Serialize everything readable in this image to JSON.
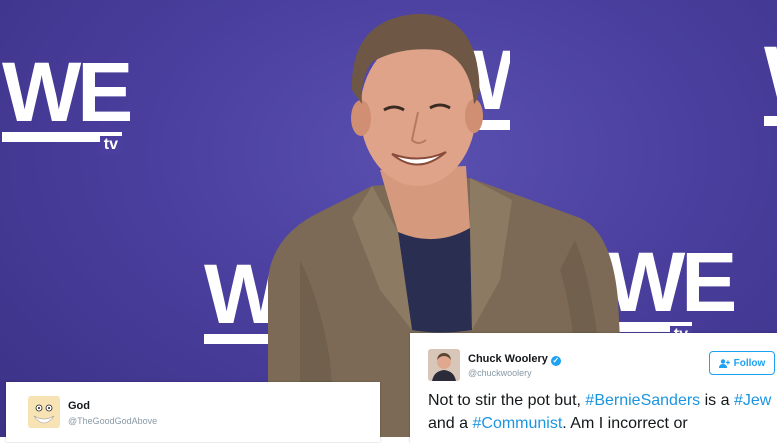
{
  "photo": {
    "backdrop_color": "#4a3f9e",
    "logo_text": "WE",
    "logo_sub": "tv"
  },
  "tweet_god": {
    "name": "God",
    "handle": "@TheGoodGodAbove"
  },
  "tweet_chuck": {
    "name": "Chuck Woolery",
    "verified": "✓",
    "handle": "@chuckwoolery",
    "follow_label": "Follow",
    "text_1": "Not to stir the pot but, ",
    "tag_bernie": "#BernieSanders",
    "text_2": " is a ",
    "tag_jew": "#Jew",
    "text_3": " and a ",
    "tag_communist": "#Communist",
    "text_4": ". Am I incorrect or"
  },
  "colors": {
    "link": "#1b95e0",
    "twitter_blue": "#1da1f2",
    "text": "#14171a",
    "muted": "#8899a6"
  }
}
